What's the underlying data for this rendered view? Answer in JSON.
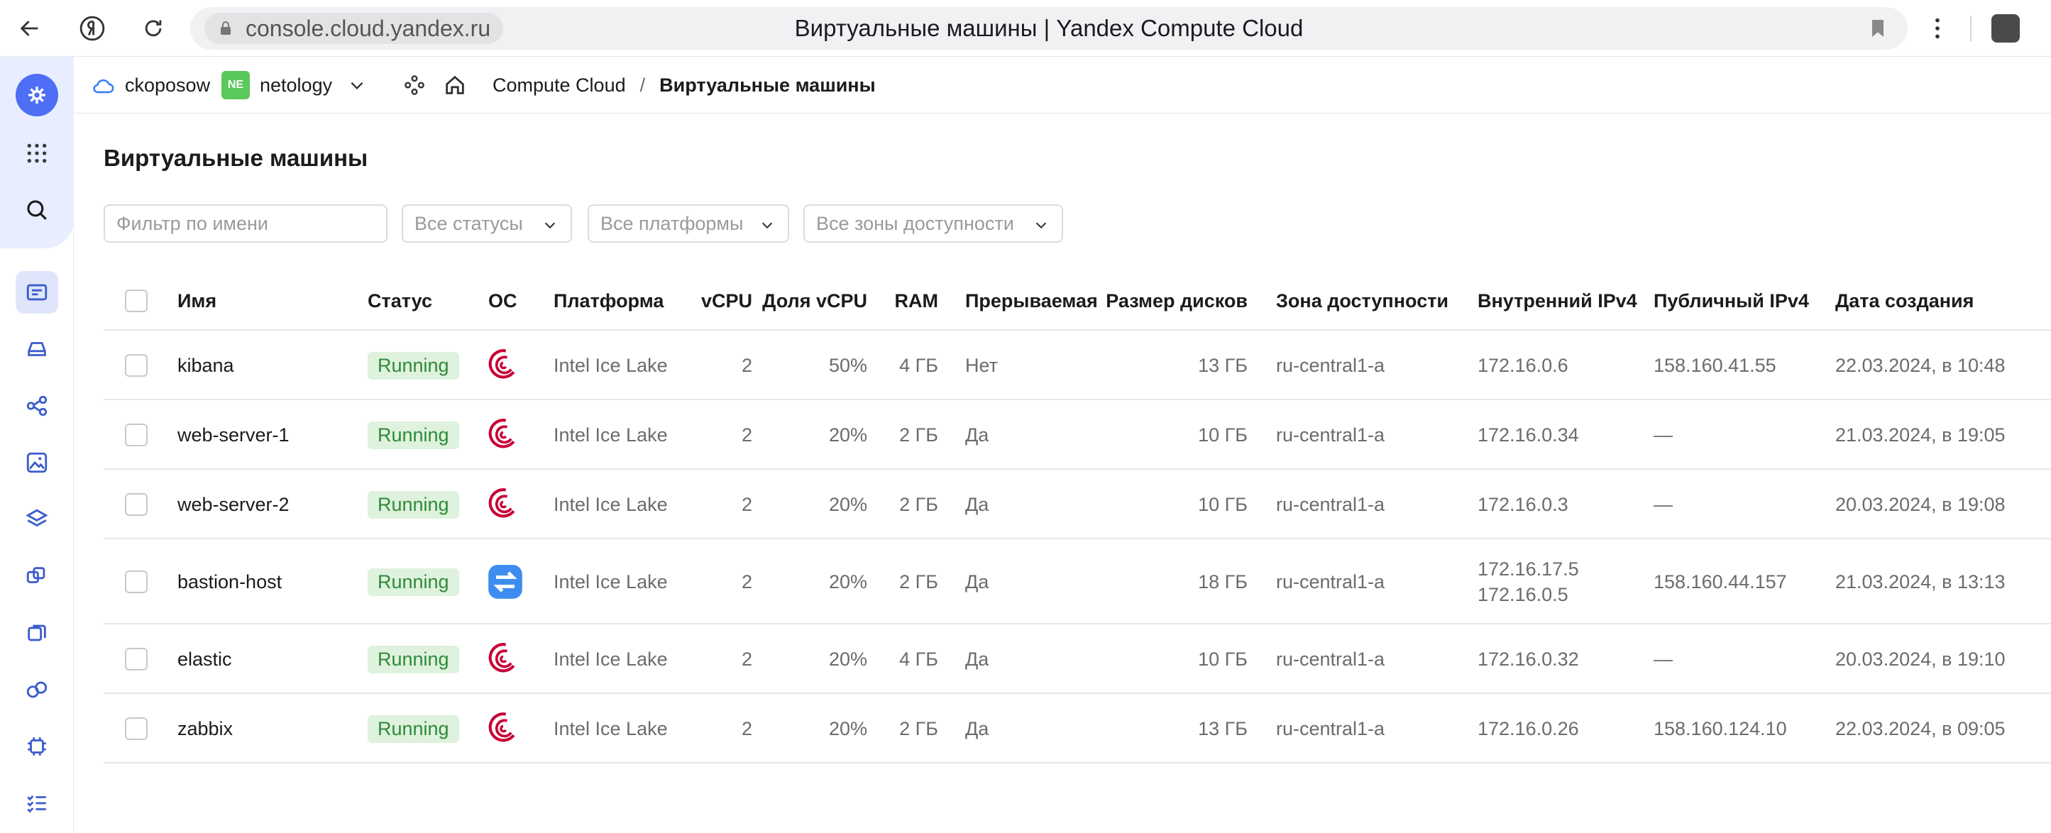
{
  "browser": {
    "url": "console.cloud.yandex.ru",
    "page_title": "Виртуальные машины | Yandex Compute Cloud"
  },
  "header": {
    "cloud_name": "ckoposow",
    "org_badge": "NE",
    "org_name": "netology",
    "breadcrumb_service": "Compute Cloud",
    "breadcrumb_separator": "/",
    "breadcrumb_current": "Виртуальные машины"
  },
  "page": {
    "title": "Виртуальные машины"
  },
  "filters": {
    "name_placeholder": "Фильтр по имени",
    "status": "Все статусы",
    "platform": "Все платформы",
    "zone": "Все зоны доступности"
  },
  "table": {
    "columns": {
      "name": "Имя",
      "status": "Статус",
      "os": "ОС",
      "platform": "Платформа",
      "vcpu": "vCPU",
      "vcpu_share": "Доля vCPU",
      "ram": "RAM",
      "preemptible": "Прерываемая",
      "disk_size": "Размер дисков",
      "zone": "Зона доступности",
      "internal_ip": "Внутренний IPv4",
      "public_ip": "Публичный IPv4",
      "created": "Дата создания"
    },
    "rows": [
      {
        "name": "kibana",
        "status": "Running",
        "os_icon": "debian-icon",
        "platform": "Intel Ice Lake",
        "vcpu": "2",
        "vcpu_share": "50%",
        "ram": "4 ГБ",
        "preemptible": "Нет",
        "disk": "13 ГБ",
        "zone": "ru-central1-a",
        "ip1": "172.16.0.6",
        "ip2": "",
        "public_ip": "158.160.41.55",
        "created": "22.03.2024, в 10:48"
      },
      {
        "name": "web-server-1",
        "status": "Running",
        "os_icon": "debian-icon",
        "platform": "Intel Ice Lake",
        "vcpu": "2",
        "vcpu_share": "20%",
        "ram": "2 ГБ",
        "preemptible": "Да",
        "disk": "10 ГБ",
        "zone": "ru-central1-a",
        "ip1": "172.16.0.34",
        "ip2": "",
        "public_ip": "—",
        "created": "21.03.2024, в 19:05"
      },
      {
        "name": "web-server-2",
        "status": "Running",
        "os_icon": "debian-icon",
        "platform": "Intel Ice Lake",
        "vcpu": "2",
        "vcpu_share": "20%",
        "ram": "2 ГБ",
        "preemptible": "Да",
        "disk": "10 ГБ",
        "zone": "ru-central1-a",
        "ip1": "172.16.0.3",
        "ip2": "",
        "public_ip": "—",
        "created": "20.03.2024, в 19:08"
      },
      {
        "name": "bastion-host",
        "status": "Running",
        "os_icon": "nat-icon",
        "platform": "Intel Ice Lake",
        "vcpu": "2",
        "vcpu_share": "20%",
        "ram": "2 ГБ",
        "preemptible": "Да",
        "disk": "18 ГБ",
        "zone": "ru-central1-a",
        "ip1": "172.16.17.5",
        "ip2": "172.16.0.5",
        "public_ip": "158.160.44.157",
        "created": "21.03.2024, в 13:13"
      },
      {
        "name": "elastic",
        "status": "Running",
        "os_icon": "debian-icon",
        "platform": "Intel Ice Lake",
        "vcpu": "2",
        "vcpu_share": "20%",
        "ram": "4 ГБ",
        "preemptible": "Да",
        "disk": "10 ГБ",
        "zone": "ru-central1-a",
        "ip1": "172.16.0.32",
        "ip2": "",
        "public_ip": "—",
        "created": "20.03.2024, в 19:10"
      },
      {
        "name": "zabbix",
        "status": "Running",
        "os_icon": "debian-icon",
        "platform": "Intel Ice Lake",
        "vcpu": "2",
        "vcpu_share": "20%",
        "ram": "2 ГБ",
        "preemptible": "Да",
        "disk": "13 ГБ",
        "zone": "ru-central1-a",
        "ip1": "172.16.0.26",
        "ip2": "",
        "public_ip": "158.160.124.10",
        "created": "22.03.2024, в 09:05"
      }
    ]
  },
  "colors": {
    "accent": "#4d6ef5",
    "status_bg": "#def2dd",
    "status_text": "#2f8a3a",
    "debian_red": "#c70036",
    "nat_blue": "#3d8df0"
  }
}
